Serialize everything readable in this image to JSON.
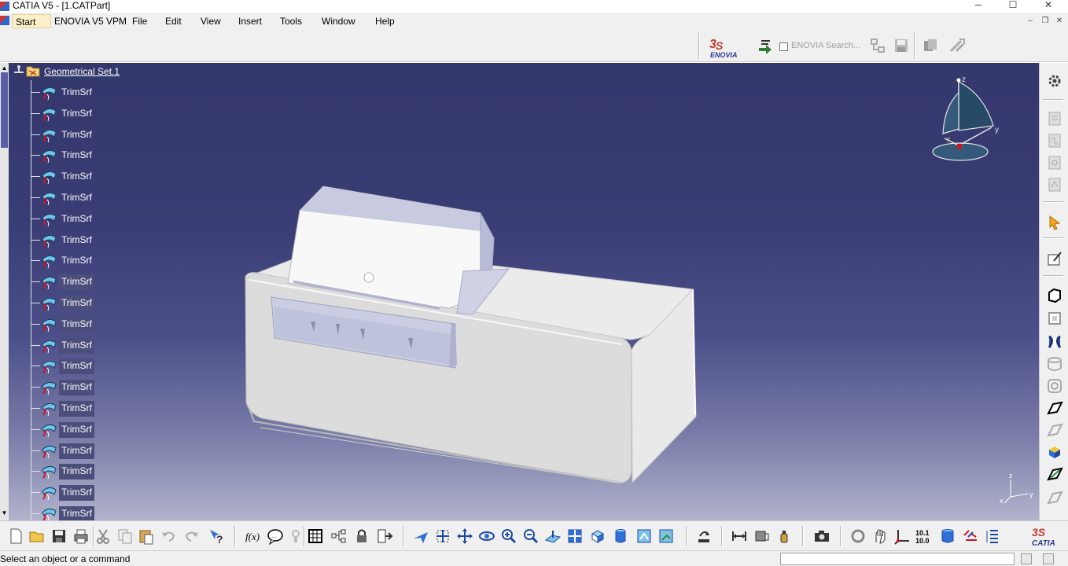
{
  "window": {
    "title": "CATIA V5 - [1.CATPart]",
    "controls": {
      "minimize": "─",
      "maximize": "☐",
      "close": "✕"
    }
  },
  "menu": {
    "items": [
      "Start",
      "ENOVIA V5 VPM",
      "File",
      "Edit",
      "View",
      "Insert",
      "Tools",
      "Window",
      "Help"
    ],
    "mdi_controls": {
      "minimize": "–",
      "restore": "❐",
      "close": "✕"
    }
  },
  "top_toolbar": {
    "enovia_logo_text": "ENOVIA",
    "enovia_search": "ENOVIA Search..."
  },
  "tree": {
    "root_label": "Geometrical Set.1",
    "item_label": "TrimSrf",
    "items": [
      {
        "label": "TrimSrf",
        "selected": false
      },
      {
        "label": "TrimSrf",
        "selected": false
      },
      {
        "label": "TrimSrf",
        "selected": false
      },
      {
        "label": "TrimSrf",
        "selected": false
      },
      {
        "label": "TrimSrf",
        "selected": false
      },
      {
        "label": "TrimSrf",
        "selected": false
      },
      {
        "label": "TrimSrf",
        "selected": false
      },
      {
        "label": "TrimSrf",
        "selected": false
      },
      {
        "label": "TrimSrf",
        "selected": false
      },
      {
        "label": "TrimSrf",
        "selected": true
      },
      {
        "label": "TrimSrf",
        "selected": true
      },
      {
        "label": "TrimSrf",
        "selected": true
      },
      {
        "label": "TrimSrf",
        "selected": true
      },
      {
        "label": "TrimSrf",
        "selected": true
      },
      {
        "label": "TrimSrf",
        "selected": true
      },
      {
        "label": "TrimSrf",
        "selected": true
      },
      {
        "label": "TrimSrf",
        "selected": true
      },
      {
        "label": "TrimSrf",
        "selected": true
      },
      {
        "label": "TrimSrf",
        "selected": true
      },
      {
        "label": "TrimSrf",
        "selected": true
      },
      {
        "label": "TrimSrf",
        "selected": true
      }
    ]
  },
  "compass": {
    "axis_z": "z",
    "axis_y": "y",
    "axis_x": "x"
  },
  "triad": {
    "axis_z": "z",
    "axis_y": "y",
    "axis_x": "x"
  },
  "bottom_toolbar": {
    "scale_label_top": "10.1",
    "scale_label_bottom": "10.0",
    "catia_logo_text": "CATIA"
  },
  "status": {
    "message": "Select an object or a command"
  },
  "colors": {
    "viewport_top": "#34376c",
    "viewport_bottom": "#b1b3cc",
    "selection": "#4b4e7a",
    "ui_background": "#f0f0f0"
  }
}
